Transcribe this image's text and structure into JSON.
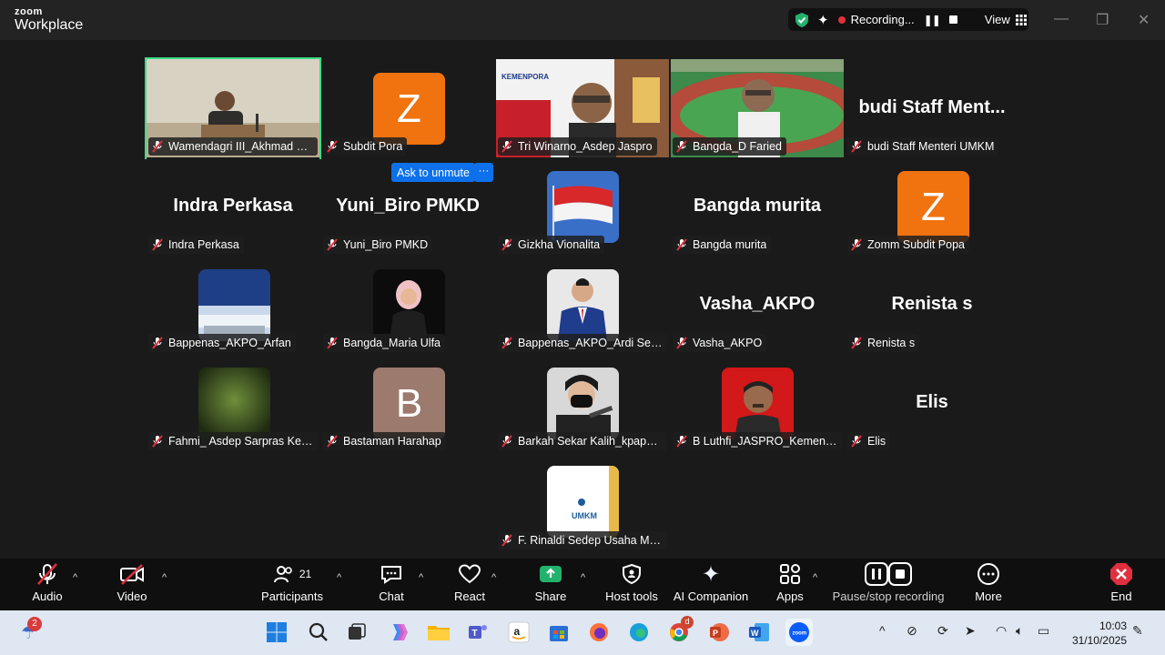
{
  "app": {
    "brand_line1": "zoom",
    "brand_line2": "Workplace"
  },
  "top_bar": {
    "recording_label": "Recording...",
    "view_label": "View"
  },
  "gallery": {
    "tiles": [
      {
        "name": "Wamendagri III_Akhmad Wiyag...",
        "big_label": "",
        "avatar_letter": ""
      },
      {
        "name": "Subdit Pora",
        "big_label": "",
        "avatar_letter": "Z"
      },
      {
        "name": "Tri Winarno_Asdep Jaspro",
        "big_label": "",
        "avatar_letter": ""
      },
      {
        "name": "Bangda_D Faried",
        "big_label": "",
        "avatar_letter": ""
      },
      {
        "name": "budi Staff Menteri UMKM",
        "big_label": "budi  Staff  Ment...",
        "avatar_letter": ""
      },
      {
        "name": "Indra Perkasa",
        "big_label": "Indra Perkasa",
        "avatar_letter": ""
      },
      {
        "name": "Yuni_Biro PMKD",
        "big_label": "Yuni_Biro PMKD",
        "avatar_letter": ""
      },
      {
        "name": "Gizkha Vionalita",
        "big_label": "",
        "avatar_letter": ""
      },
      {
        "name": "Bangda murita",
        "big_label": "Bangda murita",
        "avatar_letter": ""
      },
      {
        "name": "Zomm Subdit Popa",
        "big_label": "",
        "avatar_letter": "Z"
      },
      {
        "name": "Bappenas_AKPO_Arfan",
        "big_label": "",
        "avatar_letter": ""
      },
      {
        "name": "Bangda_Maria Ulfa",
        "big_label": "",
        "avatar_letter": ""
      },
      {
        "name": "Bappenas_AKPO_Ardi Setyo",
        "big_label": "",
        "avatar_letter": ""
      },
      {
        "name": "Vasha_AKPO",
        "big_label": "Vasha_AKPO",
        "avatar_letter": ""
      },
      {
        "name": "Renista s",
        "big_label": "Renista s",
        "avatar_letter": ""
      },
      {
        "name": "Fahmi_ Asdep Sarpras Keme...",
        "big_label": "",
        "avatar_letter": ""
      },
      {
        "name": "Bastaman Harahap",
        "big_label": "",
        "avatar_letter": "B"
      },
      {
        "name": "Barkah Sekar Kalih_kpapo B...",
        "big_label": "",
        "avatar_letter": ""
      },
      {
        "name": "B Luthfi_JASPRO_Kemenpora",
        "big_label": "",
        "avatar_letter": ""
      },
      {
        "name": "Elis",
        "big_label": "Elis",
        "avatar_letter": ""
      },
      {
        "name": "F. Rinaldi Sedep Usaha Men...",
        "big_label": "",
        "avatar_letter": ""
      }
    ],
    "video_overlays": {
      "kemenpora": "KEMENPORA",
      "umkm": "UMKM"
    },
    "ask_to_unmute": "Ask to unmute",
    "more_dots": "···"
  },
  "toolbar": {
    "audio": "Audio",
    "video": "Video",
    "participants": "Participants",
    "participants_count": "21",
    "chat": "Chat",
    "react": "React",
    "share": "Share",
    "host_tools": "Host tools",
    "ai_companion": "AI Companion",
    "apps": "Apps",
    "pause_stop": "Pause/stop recording",
    "more": "More",
    "end": "End"
  },
  "taskbar": {
    "weather_badge": "2",
    "chrome_badge": "d",
    "time": "10:03",
    "date": "31/10/2025"
  },
  "colors": {
    "accent_blue": "#0e71eb",
    "speaking_green": "#3ddc84",
    "muted_red": "#e0303f",
    "avatar_orange": "#f0730f",
    "avatar_brown": "#9c7a6e"
  }
}
